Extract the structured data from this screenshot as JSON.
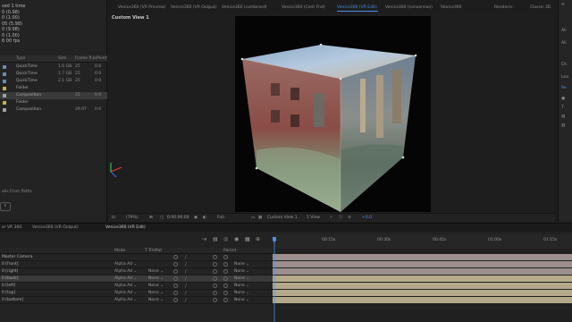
{
  "project": {
    "info_lines": [
      "sed 1 time",
      "0 (0.98)",
      "0 (1.00)",
      "05 (5.98)",
      "0 (9.98)",
      "0 (1.00)",
      "6 00 fps"
    ],
    "columns": {
      "type": "Type",
      "size": "Size",
      "frame_rate": "Frame R...",
      "extra": "InPoint"
    },
    "items": [
      {
        "type": "QuickTime",
        "size": "1.6 GB",
        "frame_rate": "25",
        "extra": "0:0",
        "swatch": "#6a8ab0"
      },
      {
        "type": "QuickTime",
        "size": "1.7 GB",
        "frame_rate": "25",
        "extra": "0:0",
        "swatch": "#6a8ab0"
      },
      {
        "type": "QuickTime",
        "size": "2.1 GB",
        "frame_rate": "25",
        "extra": "0:0",
        "swatch": "#6a8ab0"
      },
      {
        "type": "Folder",
        "size": "",
        "frame_rate": "",
        "extra": "",
        "swatch": "#c9b04a"
      },
      {
        "type": "Composition",
        "size": "",
        "frame_rate": "25",
        "extra": "0:0",
        "swatch": "#a0a0a0",
        "selected": true
      },
      {
        "type": "Folder",
        "size": "",
        "frame_rate": "",
        "extra": "",
        "swatch": "#c9b04a"
      },
      {
        "type": "Composition",
        "size": "",
        "frame_rate": "29.97",
        "extra": "0:0",
        "swatch": "#a0a0a0"
      }
    ],
    "fill_from_paths": "ails From Paths",
    "button_label": "t"
  },
  "viewer_tabs": [
    "Venice360 (VR Preview)",
    "Venice360 (VR Output)",
    "Venice360 (combined)",
    "Venice360 (Cent Fnd)",
    "Venice360 (VR Edit)",
    "Venice360 (conversion)",
    "Venice360"
  ],
  "viewer_tabs_right": [
    "Renderer:",
    "Classic 3D"
  ],
  "view_label": "Custom View 1",
  "viewer_bar": {
    "zoom": "(79%)",
    "timecode": "0:00:00:00",
    "resolution": "Full",
    "view": "Custom View 1",
    "views": "1 View",
    "exposure": "+0.0"
  },
  "right_panel": [
    "Ali",
    "Ali",
    "Ch",
    "Lea",
    "Re"
  ],
  "timeline": {
    "tabs": [
      "er VR 360",
      "Venice360 (VR Output)",
      "Venice360 (VR Edit)"
    ],
    "columns": {
      "mode": "Mode",
      "trkmat": "T TrkMat",
      "parent": "Parent"
    },
    "ruler": [
      "00:15s",
      "00:30s",
      "00:45s",
      "01:00s",
      "01:15s"
    ],
    "layers": [
      {
        "name": "Master Camera",
        "mode": "",
        "trkmat": "",
        "parent": "",
        "track": "#9e8f8f"
      },
      {
        "name": "0 [front]",
        "mode": "Alpha Ad",
        "trkmat": "",
        "parent": "None",
        "track": "#9e8f8f"
      },
      {
        "name": "0 [right]",
        "mode": "Alpha Ad",
        "trkmat": "None",
        "parent": "None",
        "track": "#9e8f8f"
      },
      {
        "name": "0 [back]",
        "mode": "Alpha Ad",
        "trkmat": "None",
        "parent": "None",
        "track": "#b4a98a",
        "selected": true
      },
      {
        "name": "0 [left]",
        "mode": "Alpha Ad",
        "trkmat": "None",
        "parent": "None",
        "track": "#b4a98a"
      },
      {
        "name": "0 [top]",
        "mode": "Alpha Ad",
        "trkmat": "None",
        "parent": "None",
        "track": "#b4a98a"
      },
      {
        "name": "0 [bottom]",
        "mode": "Alpha Ad",
        "trkmat": "None",
        "parent": "None",
        "track": "#b4a98a"
      }
    ]
  },
  "colors": {
    "accent": "#4a8fe8",
    "playhead": "#4a8fe8"
  }
}
